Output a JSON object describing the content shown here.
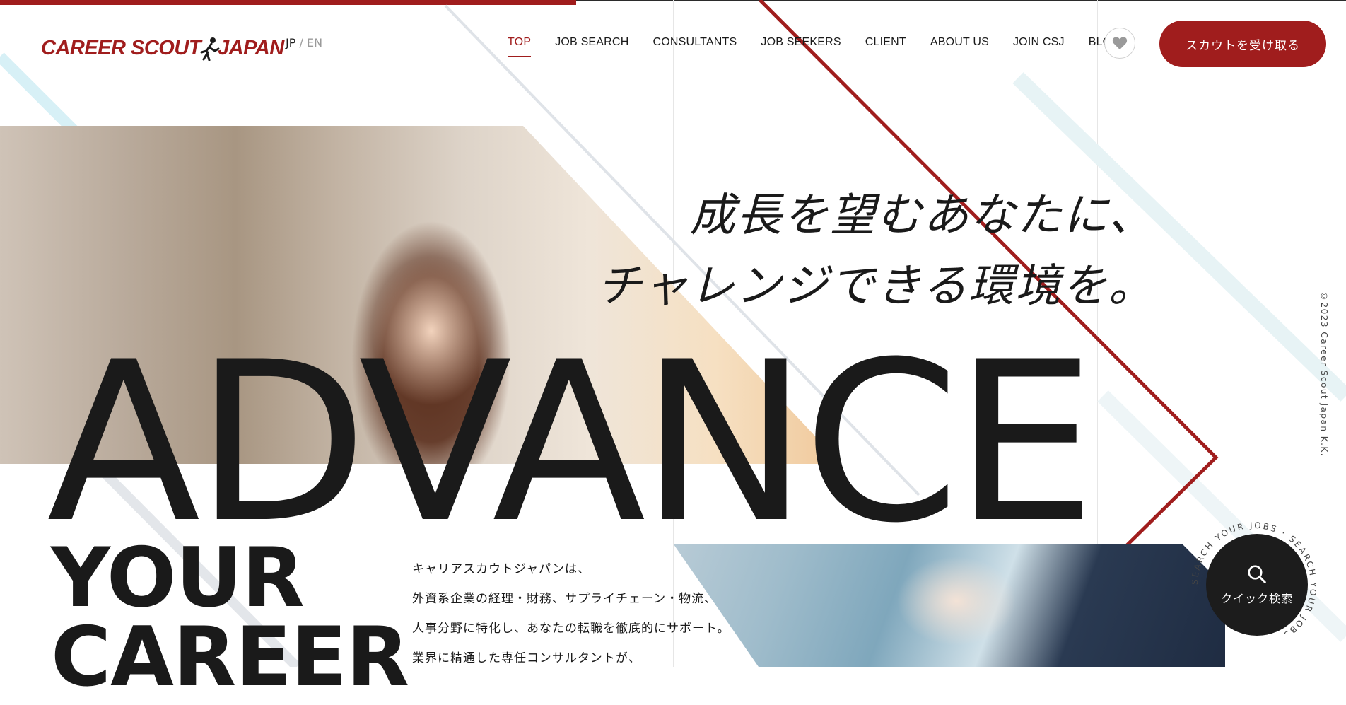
{
  "brand": {
    "logo_text_left": "CAREER SCOUT",
    "logo_text_right": "JAPAN"
  },
  "lang": {
    "jp": "JP",
    "sep": "/",
    "en": "EN"
  },
  "nav": {
    "items": [
      "TOP",
      "JOB SEARCH",
      "CONSULTANTS",
      "JOB SEEKERS",
      "CLIENT",
      "ABOUT US",
      "JOIN CSJ",
      "BLOG"
    ],
    "active": "TOP"
  },
  "header": {
    "fav_icon": "heart-icon",
    "scout_label": "スカウトを受け取る"
  },
  "hero": {
    "catch_line1": "成長を望むあなたに、",
    "catch_line2": "チャレンジできる環境を。",
    "big_word": "ADVANCE",
    "sub_word_1": "YOUR",
    "sub_word_2": "CAREER",
    "intro_lines": [
      "キャリアスカウトジャパンは、",
      "外資系企業の経理・財務、サプライチェーン・物流、",
      "人事分野に特化し、あなたの転職を徹底的にサポート。",
      "業界に精通した専任コンサルタントが、"
    ]
  },
  "copyright": "©2023 Career Scout Japan K.K.",
  "quick_search": {
    "label": "クイック検索",
    "ring_text": "SEARCH YOUR JOBS · SEARCH YOUR JOBS ·",
    "icon": "search-icon"
  },
  "colors": {
    "brand_red": "#a01d1d",
    "dark": "#1a1a1a",
    "cyan_stripe": "#d7f0f6"
  }
}
